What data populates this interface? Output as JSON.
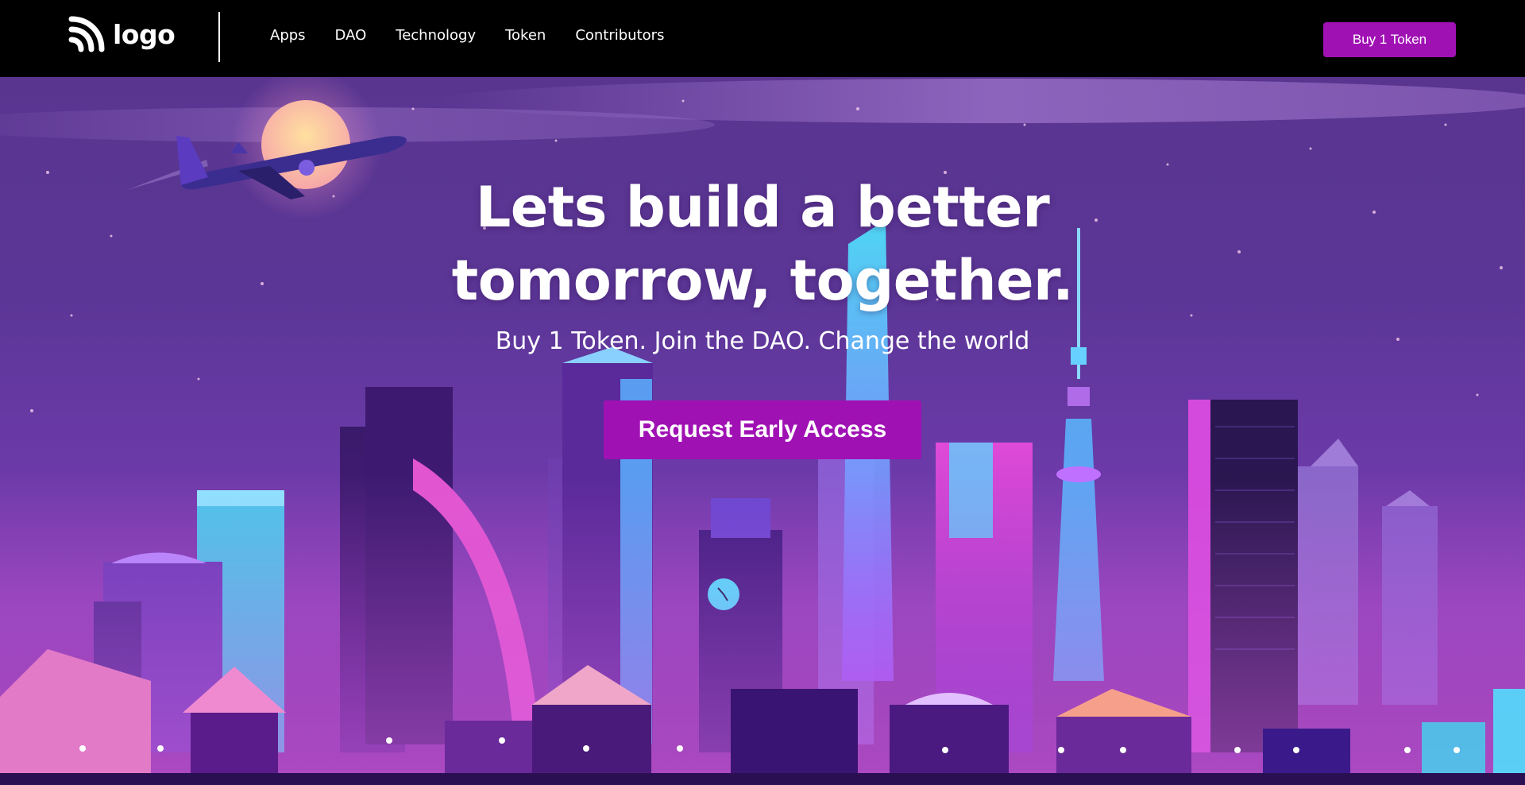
{
  "header": {
    "logo_text": "logo",
    "nav": [
      "Apps",
      "DAO",
      "Technology",
      "Token",
      "Contributors"
    ],
    "cta_label": "Buy 1 Token"
  },
  "hero": {
    "title_line1": "Lets build a better",
    "title_line2": "tomorrow, together.",
    "subtitle": "Buy 1 Token. Join the DAO. Change the world",
    "cta_label": "Request Early Access"
  },
  "colors": {
    "accent": "#a011b4",
    "header_bg": "#000000",
    "sky": "#5b3696"
  },
  "icons": {
    "logo": "wifi-signal-icon"
  }
}
